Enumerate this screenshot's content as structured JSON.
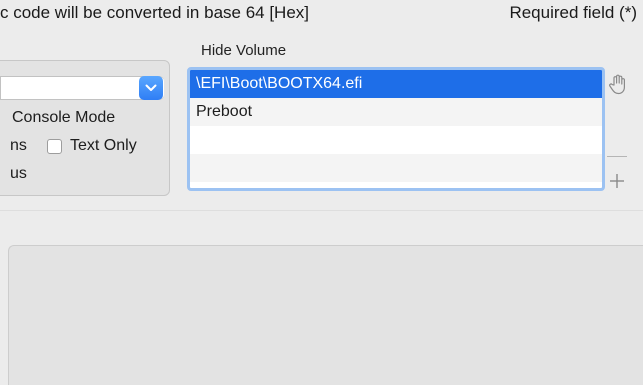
{
  "header": {
    "notice": "c code will be converted in base 64 [Hex]",
    "required_note": "Required field (*)"
  },
  "options": {
    "console_mode_label": "Console Mode",
    "row2_prefix": "ns",
    "text_only_label": "Text Only",
    "row3_text": "us",
    "text_only_checked": false,
    "popup_value": ""
  },
  "hide_volume": {
    "label": "Hide Volume",
    "rows": [
      "\\EFI\\Boot\\BOOTX64.efi",
      "Preboot",
      "",
      ""
    ],
    "selected_index": 0
  },
  "icons": {
    "drag": "hand-icon",
    "add": "plus-icon"
  },
  "colors": {
    "selection": "#1e6ee8",
    "focus_ring": "#9cc2f2",
    "popup_arrow": "#2f7ef5"
  }
}
